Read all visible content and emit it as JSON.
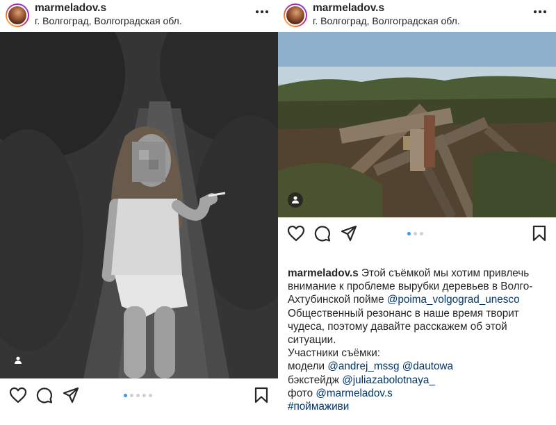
{
  "left_post": {
    "username": "marmeladov.s",
    "location": "г. Волгоград, Волгоградская обл.",
    "carousel": {
      "count": 5,
      "active": 0
    },
    "icons": {
      "more": "more-icon",
      "like": "heart-icon",
      "comment": "comment-icon",
      "share": "share-icon",
      "save": "bookmark-icon",
      "tag": "user-tag-icon"
    }
  },
  "right_post": {
    "username": "marmeladov.s",
    "location": "г. Волгоград, Волгоградская обл.",
    "carousel": {
      "count": 3,
      "active": 0
    },
    "caption": {
      "username": "marmeladov.s",
      "text1": "Этой съёмкой мы хотим привлечь внимание к проблеме вырубки деревьев в Волго-Ахтубинской пойме",
      "mention1": "@poima_volgograd_unesco",
      "text2": "Общественный резонанс в наше время творит чудеса, поэтому давайте расскажем об этой ситуации.",
      "participants_label": "Участники съёмки:",
      "models_label": "модели",
      "model1": "@andrej_mssg",
      "model2": "@dautowa",
      "backstage_label": "бэкстейдж",
      "backstage": "@juliazabolotnaya_",
      "photo_label": "фото",
      "photo": "@marmeladov.s",
      "hashtag": "#поймаживи"
    }
  }
}
